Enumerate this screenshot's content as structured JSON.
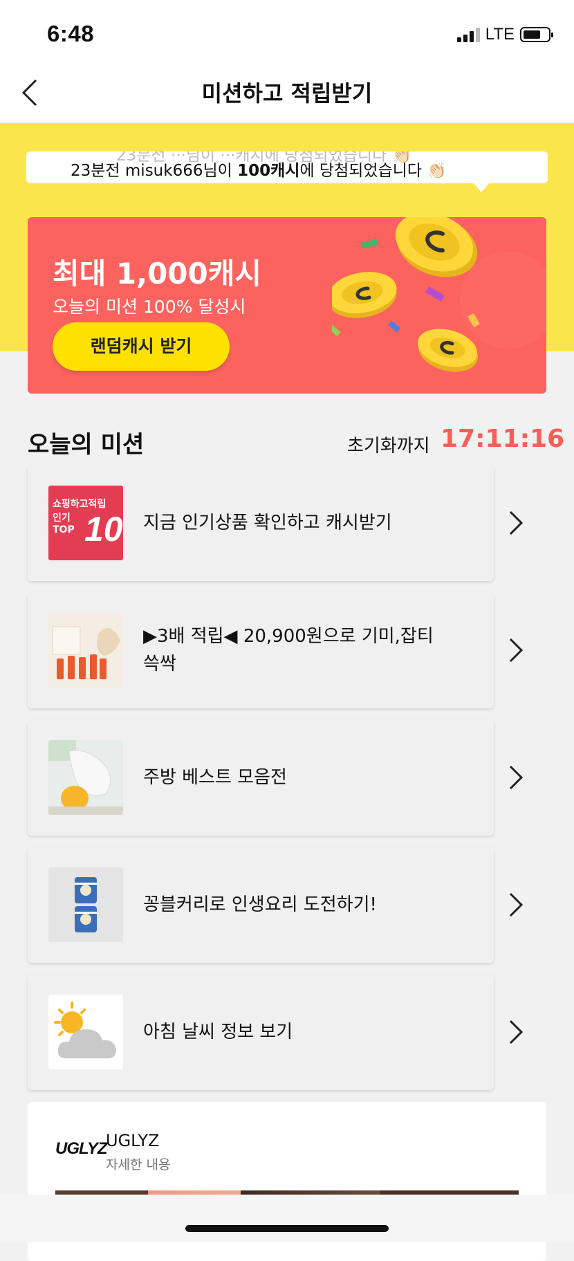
{
  "status_bar": {
    "time": "6:48",
    "network": "LTE",
    "battery_level": 0.7
  },
  "nav": {
    "title": "미션하고 적립받기",
    "back_icon": "chevron-left-icon"
  },
  "ticker": {
    "prefix": "23분전 misuk666님이 ",
    "amount": "100캐시",
    "suffix": "에 당첨되었습니다 👏🏻",
    "previous_line": "23분전 ···님이 ···캐시에 당첨되었습니다 👏🏻"
  },
  "promo": {
    "title": "최대 1,000캐시",
    "subtitle": "오늘의 미션 100% 달성시",
    "button_label": "랜덤캐시 받기",
    "background_color": "#fc625e",
    "button_color": "#ffe100",
    "coin_icon": "coin-icon"
  },
  "missions_section": {
    "title": "오늘의 미션",
    "timer_label": "초기화까지",
    "timer_value": "17:11:16",
    "timer_color": "#fb5d57"
  },
  "missions": [
    {
      "text": "지금 인기상품 확인하고 캐시받기",
      "thumb_line1": "쇼핑하고적립",
      "thumb_line2": "인기",
      "thumb_line3": "TOP",
      "thumb_number": "10"
    },
    {
      "text": "▶3배 적립◀ 20,900원으로 기미,잡티 쓱싹",
      "thumb": "lipstick-product-image"
    },
    {
      "text": "주방 베스트 모음전",
      "thumb": "kitchen-gloves-image"
    },
    {
      "text": "꽁블커리로 인생요리 도전하기!",
      "thumb": "curry-can-image"
    },
    {
      "text": "아침 날씨 정보 보기",
      "thumb": "weather-icon"
    }
  ],
  "ad": {
    "logo": "UGLYZ",
    "name": "UGLYZ",
    "detail": "자세한 내용"
  },
  "colors": {
    "yellow_band": "#fbe54c",
    "page_bg": "#f1f1f1"
  }
}
